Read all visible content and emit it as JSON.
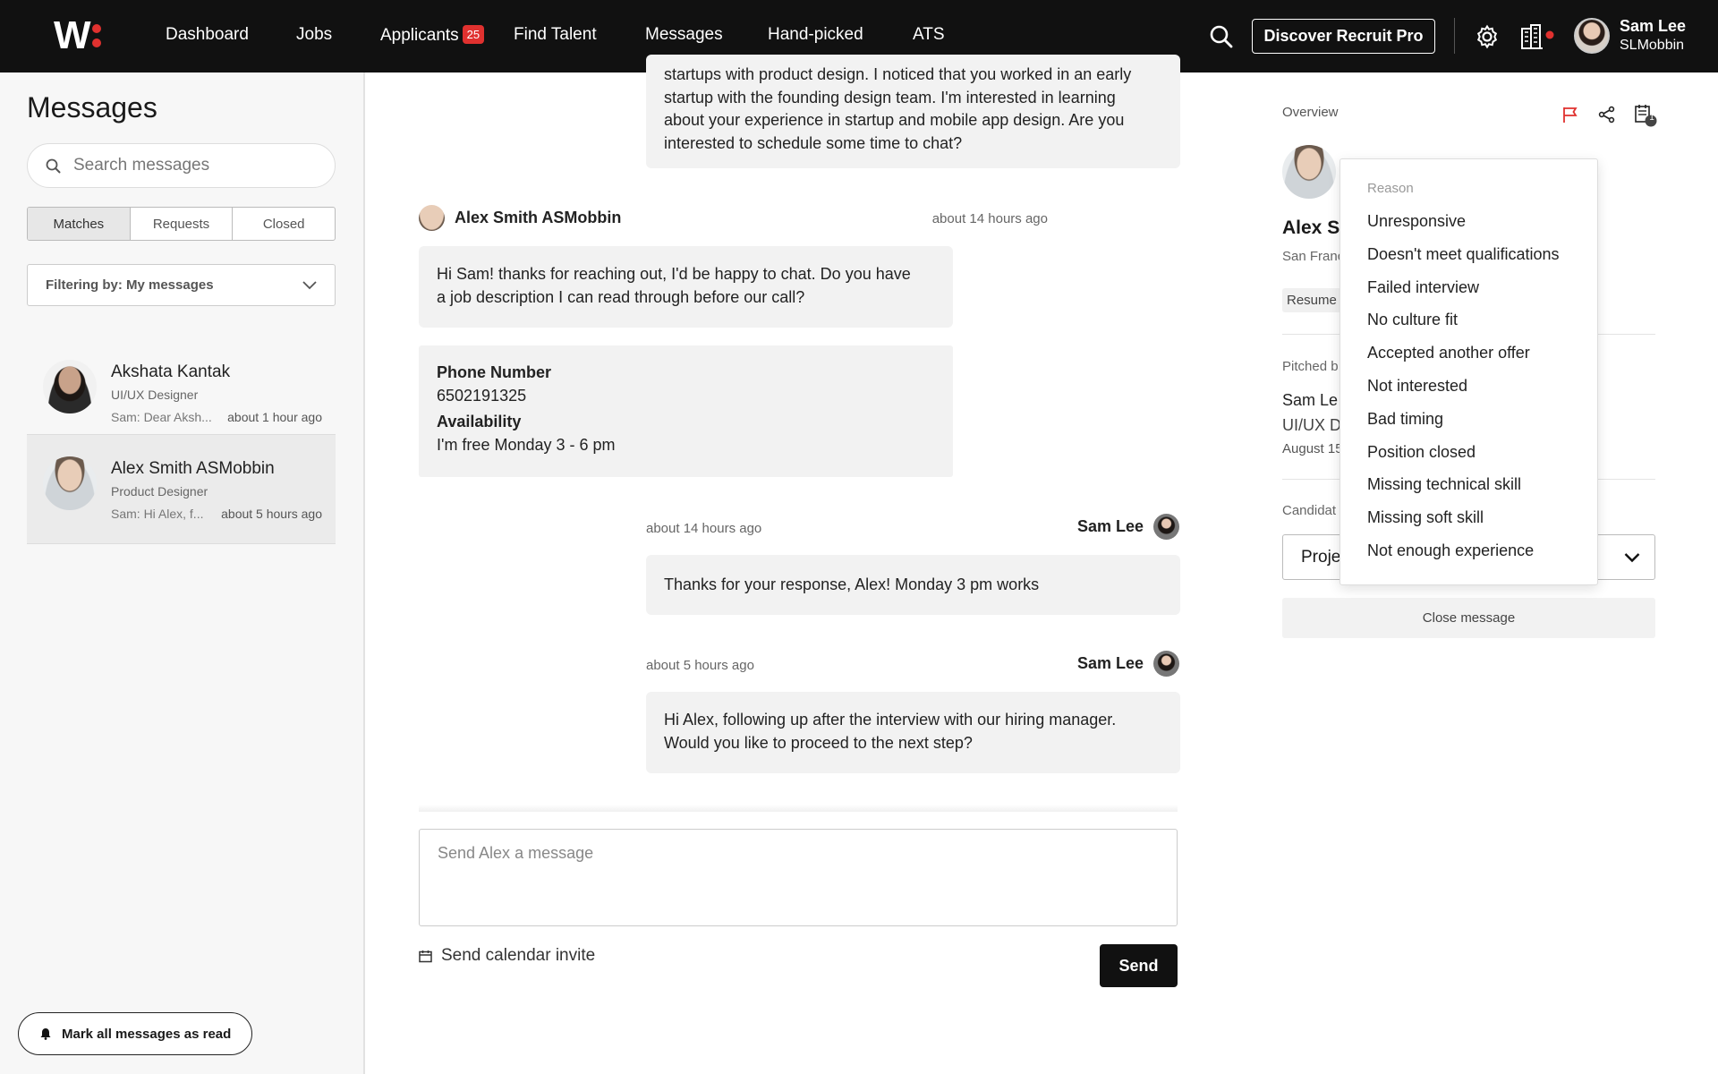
{
  "nav": {
    "items": [
      "Dashboard",
      "Jobs",
      "Applicants",
      "Find Talent",
      "Messages",
      "Hand-picked",
      "ATS"
    ],
    "applicants_badge": "25",
    "active": "Messages",
    "discover_label": "Discover Recruit Pro",
    "user_name": "Sam Lee",
    "user_handle": "SLMobbin",
    "icons": [
      "search-icon",
      "gear-icon",
      "building-icon"
    ],
    "notification_dot_color": "#e0312f"
  },
  "sidebar": {
    "title": "Messages",
    "search_placeholder": "Search messages",
    "tabs": [
      "Matches",
      "Requests",
      "Closed"
    ],
    "active_tab": "Matches",
    "filter_label": "Filtering by: My messages",
    "conversations": [
      {
        "name": "Akshata Kantak",
        "role": "UI/UX Designer",
        "snippet": "Sam: Dear Aksh...",
        "time": "about 1 hour ago"
      },
      {
        "name": "Alex Smith ASMobbin",
        "role": "Product Designer",
        "snippet": "Sam: Hi Alex, f...",
        "time": "about 5 hours ago"
      }
    ],
    "mark_read_label": "Mark all messages as read"
  },
  "chat": {
    "first_bubble_lines": [
      "startups with product design. I noticed that you worked in an early",
      "startup with the founding design team. I'm interested in learning",
      "about your experience in startup and mobile app design. Are you",
      "interested to schedule some time to chat?"
    ],
    "msg1": {
      "sender": "Alex Smith ASMobbin",
      "time": "about 14 hours ago",
      "line1": "Hi Sam! thanks for reaching out, I'd be happy to chat. Do you have",
      "line2": "a job description I can read through before our call?"
    },
    "info_card": {
      "phone_label": "Phone Number",
      "phone_value": "6502191325",
      "availability_label": "Availability",
      "availability_value": "I'm free Monday 3 - 6 pm"
    },
    "msg2": {
      "sender": "Sam Lee",
      "time": "about 14 hours ago",
      "text": "Thanks for your response, Alex! Monday 3 pm works"
    },
    "msg3": {
      "sender": "Sam Lee",
      "time": "about 5 hours ago",
      "line1": "Hi Alex, following up after the interview with our hiring manager.",
      "line2": "Would you like to proceed to the next step?"
    },
    "compose_placeholder": "Send Alex a message",
    "calendar_label": "Send calendar invite",
    "send_label": "Send"
  },
  "overview": {
    "label": "Overview",
    "calendar_badge": "1",
    "candidate_name": "Alex Sr",
    "location": "San Franc",
    "resume_tag": "Resume",
    "pitched_label": "Pitched b",
    "pitched_name": "Sam Le",
    "pitched_role": "UI/UX D",
    "pitched_date": "August 15",
    "candidate_label": "Candidat",
    "stage_value": "Proje",
    "close_label": "Close message"
  },
  "reason_dropdown": {
    "header": "Reason",
    "options": [
      "Unresponsive",
      "Doesn't meet qualifications",
      "Failed interview",
      "No culture fit",
      "Accepted another offer",
      "Not interested",
      "Bad timing",
      "Position closed",
      "Missing technical skill",
      "Missing soft skill",
      "Not enough experience"
    ]
  }
}
